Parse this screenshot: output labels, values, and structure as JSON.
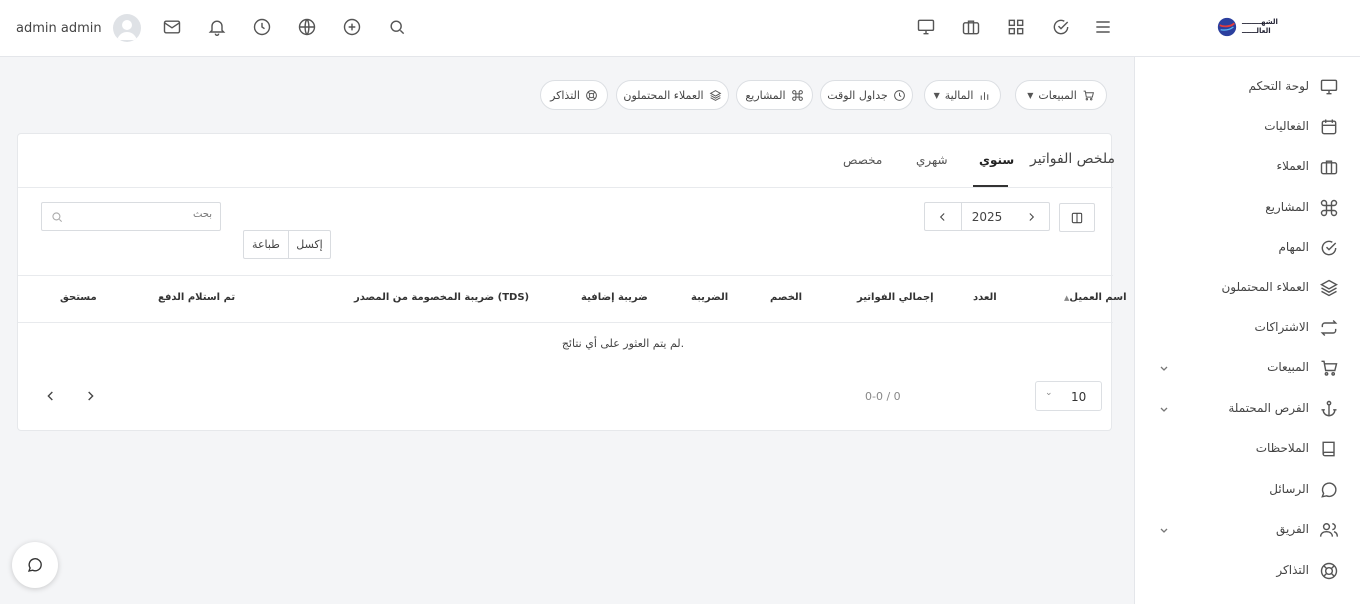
{
  "header": {
    "user_name": "admin admin",
    "logo_line1": "الشهــــــــ",
    "logo_line2": "العالــــــ"
  },
  "sidebar": {
    "items": [
      {
        "label": "لوحة التحكم",
        "icon": "monitor-icon"
      },
      {
        "label": "الفعاليات",
        "icon": "calendar-icon"
      },
      {
        "label": "العملاء",
        "icon": "briefcase-icon"
      },
      {
        "label": "المشاريع",
        "icon": "command-icon"
      },
      {
        "label": "المهام",
        "icon": "check-circle-icon"
      },
      {
        "label": "العملاء المحتملون",
        "icon": "layers-icon"
      },
      {
        "label": "الاشتراكات",
        "icon": "repeat-icon"
      },
      {
        "label": "المبيعات",
        "icon": "cart-icon"
      },
      {
        "label": "الفرص المحتملة",
        "icon": "anchor-icon"
      },
      {
        "label": "الملاحظات",
        "icon": "book-icon"
      },
      {
        "label": "الرسائل",
        "icon": "chat-icon"
      },
      {
        "label": "الفريق",
        "icon": "users-icon"
      },
      {
        "label": "التذاكر",
        "icon": "lifebuoy-icon"
      }
    ]
  },
  "quick_nav": {
    "sales": "المبيعات",
    "finance": "المالية",
    "timesheets": "جداول الوقت",
    "projects": "المشاريع",
    "leads": "العملاء المحتملون",
    "tickets": "التذاكر"
  },
  "card": {
    "title": "ملخص الفواتير",
    "tabs": {
      "yearly": "سنوي",
      "monthly": "شهري",
      "custom": "مخصص"
    },
    "year": "2025",
    "excel_label": "إكسل",
    "print_label": "طباعة",
    "search_placeholder": "بحث"
  },
  "table": {
    "headers": {
      "client": "اسم العميل",
      "count": "العدد",
      "total": "إجمالي الفواتير",
      "discount": "الخصم",
      "tax": "الضريبة",
      "second_tax": "ضريبة إضافية",
      "tds": "ضريبة المخصومة من المصدر (TDS)",
      "payment_received": "تم استلام الدفع",
      "due": "مستحق"
    },
    "empty_message": "لم يتم العثور على أي نتائج."
  },
  "pagination": {
    "page_size": "10",
    "range": "0-0 / 0"
  }
}
